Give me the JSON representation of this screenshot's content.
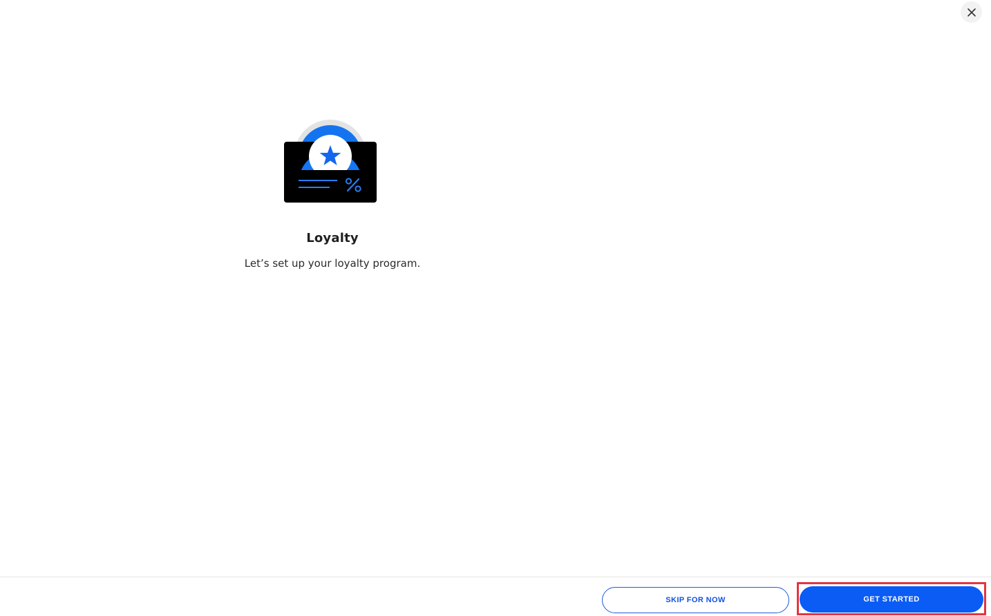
{
  "window": {
    "close_icon": "close-icon"
  },
  "hero": {
    "illustration_icon": "loyalty-badge-card-icon",
    "title": "Loyalty",
    "subtitle": "Let’s set up your loyalty program."
  },
  "footer": {
    "skip_label": "SKIP FOR NOW",
    "primary_label": "GET STARTED"
  },
  "colors": {
    "accent": "#0b5cf5",
    "outline": "#1e5bd8",
    "highlight": "#e3343f",
    "card": "#000000"
  }
}
